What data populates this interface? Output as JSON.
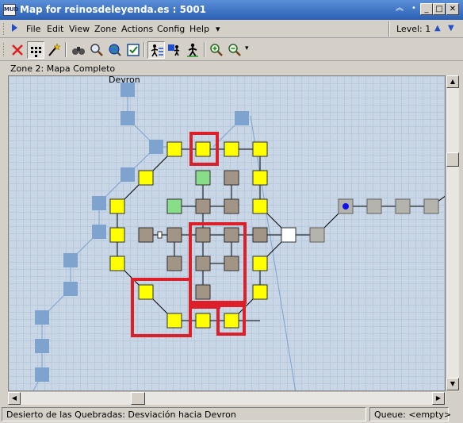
{
  "window": {
    "title": "Map for reinosdeleyenda.es : 5001",
    "app_icon_text": "MUD"
  },
  "menu": {
    "items": [
      "File",
      "Edit",
      "View",
      "Zone",
      "Actions",
      "Config",
      "Help"
    ],
    "overflow": "▾",
    "level_label": "Level: 1"
  },
  "toolbar": {
    "icons": [
      "delete-icon",
      "grid-dots-icon",
      "magic-wand-icon",
      "binoculars-icon",
      "magnifier-icon",
      "globe-search-icon",
      "checkbox-icon",
      "speedwalk-icon",
      "walker-path-icon",
      "walking-figure-icon",
      "zoom-in-icon",
      "zoom-out-icon"
    ]
  },
  "zone": {
    "label": "Zone 2: Mapa Completo"
  },
  "map": {
    "visible_label": "Devron",
    "colors": {
      "yellow_room": "#ffff00",
      "gray_room": "#a39585",
      "green_room": "#88dd88",
      "white_room": "#ffffff",
      "light_gray_room": "#b4b4ac",
      "faded_room": "#7ea3cf",
      "highlight": "#dd1f2a",
      "player_dot": "#1010ee"
    }
  },
  "status": {
    "room_text": "Desierto de las Quebradas: Desviación hacia Devron",
    "queue_text": "Queue: <empty>"
  }
}
